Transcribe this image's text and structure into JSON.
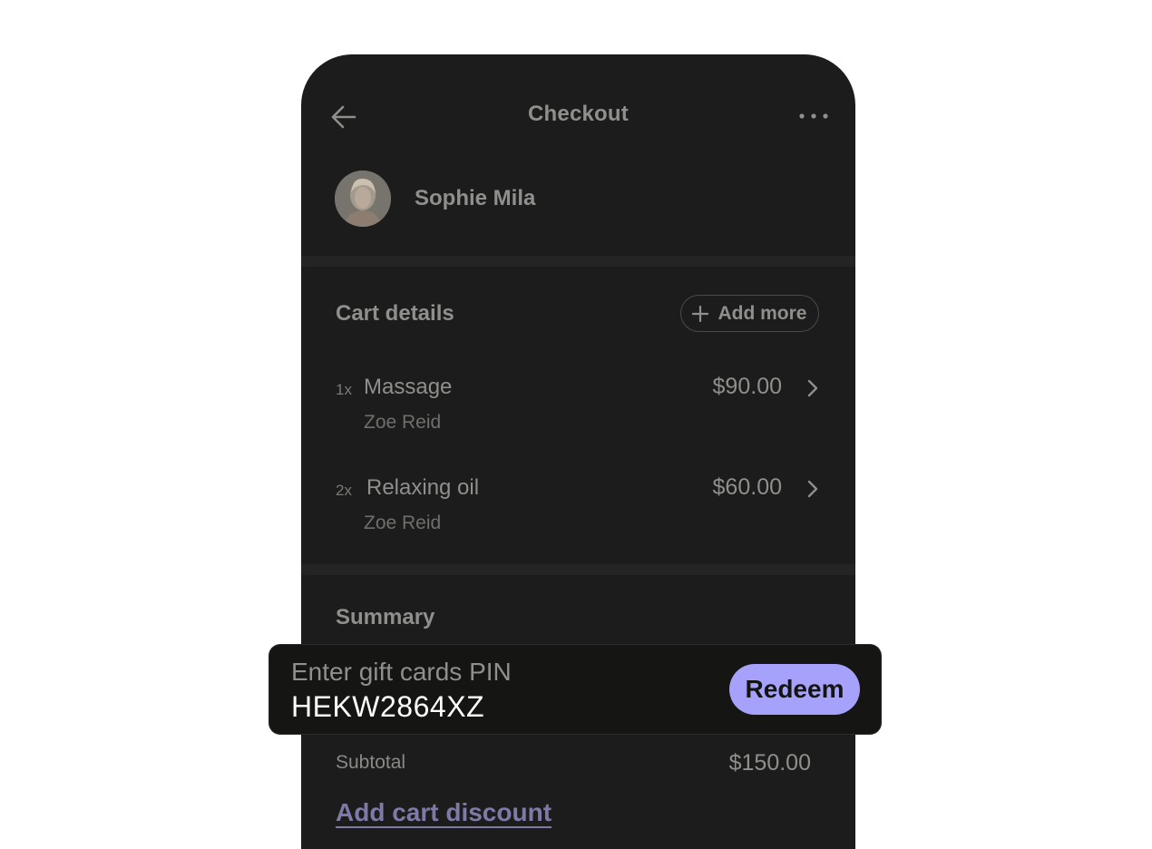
{
  "header": {
    "title": "Checkout"
  },
  "customer": {
    "name": "Sophie Mila"
  },
  "cart": {
    "section_title": "Cart details",
    "add_more_label": "Add more",
    "items": [
      {
        "qty": "1x",
        "name": "Massage",
        "staff": "Zoe Reid",
        "price": "$90.00"
      },
      {
        "qty": "2x",
        "name": "Relaxing oil",
        "staff": "Zoe Reid",
        "price": "$60.00"
      }
    ]
  },
  "summary": {
    "section_title": "Summary",
    "subtotal_label": "Subtotal",
    "subtotal_value": "$150.00",
    "discount_link": "Add cart discount"
  },
  "gift_card": {
    "label": "Enter gift cards PIN",
    "value": "HEKW2864XZ",
    "redeem_label": "Redeem"
  },
  "colors": {
    "background": "#ffffff",
    "surface": "#1b1c1b",
    "accent": "#a6a2fb",
    "link": "#7d7aa8"
  }
}
